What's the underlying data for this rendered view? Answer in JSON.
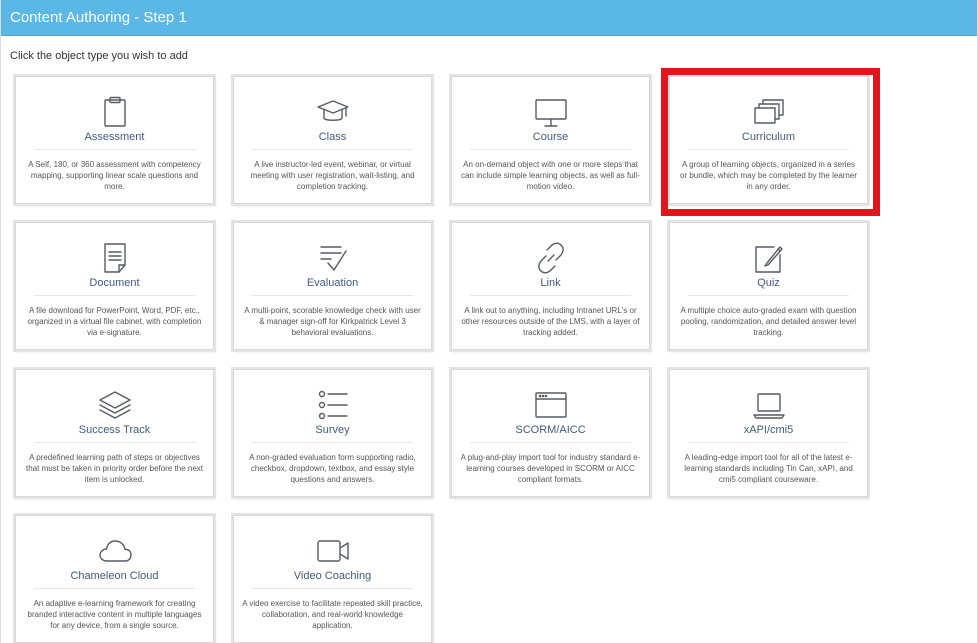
{
  "window": {
    "title": "Content Authoring - Step 1"
  },
  "instruction": "Click the object type you wish to add",
  "highlight_color": "#e0161a",
  "cards": [
    {
      "icon": "clipboard-icon",
      "title": "Assessment",
      "desc": "A Self, 180, or 360 assessment with competency mapping, supporting linear scale questions and more."
    },
    {
      "icon": "graduation-cap-icon",
      "title": "Class",
      "desc": "A live instructor-led event, webinar, or virtual meeting with user registration, wait-listing, and completion tracking."
    },
    {
      "icon": "monitor-icon",
      "title": "Course",
      "desc": "An on-demand object with one or more steps that can include simple learning objects, as well as full-motion video."
    },
    {
      "icon": "stacked-pages-icon",
      "title": "Curriculum",
      "desc": "A group of learning objects, organized in a series or bundle, which may be completed by the learner in any order."
    },
    {
      "icon": "document-icon",
      "title": "Document",
      "desc": "A file download for PowerPoint, Word, PDF, etc., organized in a virtual file cabinet, with completion via e-signature."
    },
    {
      "icon": "checklist-icon",
      "title": "Evaluation",
      "desc": "A multi-point, scorable knowledge check with user & manager sign-off for Kirkpatrick Level 3 behavioral evaluations."
    },
    {
      "icon": "link-icon",
      "title": "Link",
      "desc": "A link out to anything, including Intranet URL's or other resources outside of the LMS, with a layer of tracking added."
    },
    {
      "icon": "edit-pencil-icon",
      "title": "Quiz",
      "desc": "A multiple choice auto-graded exam with question pooling, randomization, and detailed answer level tracking."
    },
    {
      "icon": "layers-icon",
      "title": "Success Track",
      "desc": "A predefined learning path of steps or objectives that must be taken in priority order before the next item is unlocked."
    },
    {
      "icon": "list-icon",
      "title": "Survey",
      "desc": "A non-graded evaluation form supporting radio, checkbox, dropdown, textbox, and essay style questions and answers."
    },
    {
      "icon": "browser-window-icon",
      "title": "SCORM/AICC",
      "desc": "A plug-and-play import tool for industry standard e-learning courses developed in SCORM or AICC compliant formats."
    },
    {
      "icon": "laptop-icon",
      "title": "xAPI/cmi5",
      "desc": "A leading-edge import tool for all of the latest e-learning standards including Tin Can, xAPI, and cmi5 compliant courseware."
    },
    {
      "icon": "cloud-icon",
      "title": "Chameleon Cloud",
      "desc": "An adaptive e-learning framework for creating branded interactive content in multiple languages for any device, from a single source."
    },
    {
      "icon": "video-camera-icon",
      "title": "Video Coaching",
      "desc": "A video exercise to facilitate repeated skill practice, collaboration, and real-world knowledge application."
    }
  ]
}
